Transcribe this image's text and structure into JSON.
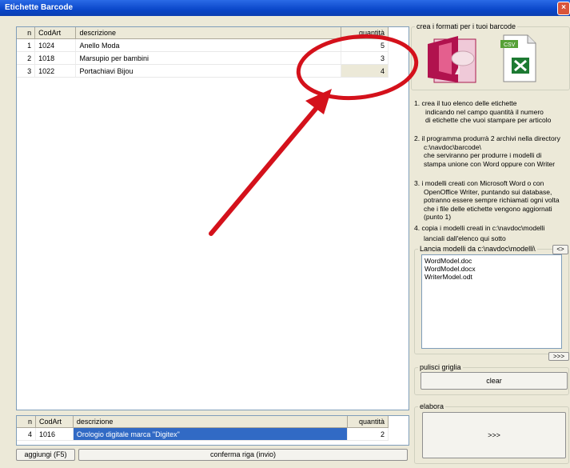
{
  "window": {
    "title": "Etichette Barcode",
    "close": "×"
  },
  "grid": {
    "headers": [
      "n",
      "CodArt",
      "descrizione",
      "quantità"
    ],
    "rows": [
      {
        "n": "1",
        "cod": "1024",
        "desc": "Anello Moda",
        "qty": "5"
      },
      {
        "n": "2",
        "cod": "1018",
        "desc": "Marsupio per bambini",
        "qty": "3"
      },
      {
        "n": "3",
        "cod": "1022",
        "desc": "Portachiavi Bijou",
        "qty": "4"
      }
    ]
  },
  "entry": {
    "headers": [
      "n",
      "CodArt",
      "descrizione",
      "quantità"
    ],
    "row": {
      "n": "4",
      "cod": "1016",
      "desc": "Orologio digitale marca \"Digitex\"",
      "qty": "2"
    }
  },
  "buttons": {
    "add": "aggiungi (F5)",
    "confirm": "conferma riga (invio)",
    "clear": "clear",
    "run": ">>>",
    "expand": ">>>",
    "browse": "<>"
  },
  "formats": {
    "label": "crea i formati per i tuoi barcode",
    "csv_tag": "CSV"
  },
  "instructions": [
    "1. crea il tuo elenco delle etichette",
    "indicando nel campo quantità il numero",
    "di etichette che vuoi stampare per articolo",
    "2. il programma produrrà 2 archivi nella directory",
    "c:\\navdoc\\barcode\\",
    "che serviranno per produrre i modelli di",
    "stampa unione con Word oppure con Writer",
    "3. i modelli creati con Microsoft Word o con",
    "OpenOffice Writer, puntando sui database,",
    "potranno essere sempre richiamati ogni volta",
    "che i file delle etichette vengono aggiornati",
    "(punto 1)",
    "4. copia i modelli creati in c:\\navdoc\\modelli",
    "lanciali dall'elenco qui sotto"
  ],
  "models": {
    "label": "Lancia modelli da c:\\navdoc\\modelli\\",
    "files": [
      "WordModel.doc",
      "WordModel.docx",
      "WriterModel.odt"
    ]
  },
  "groups": {
    "clear": "pulisci griglia",
    "run": "elabora"
  },
  "colors": {
    "annotation": "#d4111b",
    "selection": "#316ac5"
  }
}
